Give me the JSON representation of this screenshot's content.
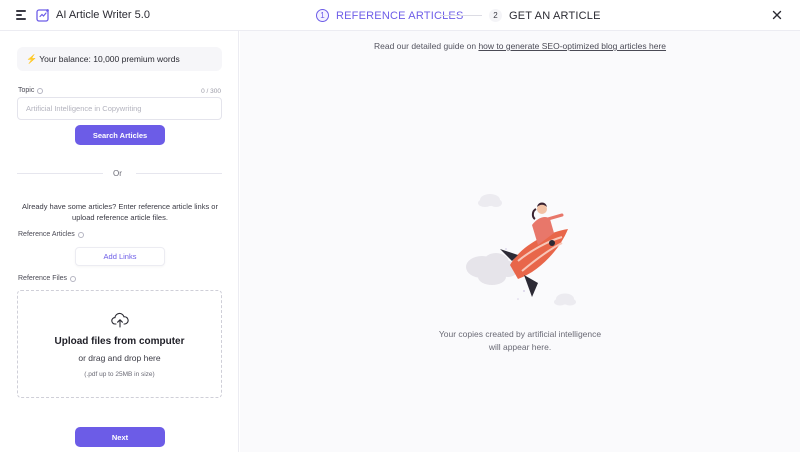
{
  "app": {
    "title": "AI Article Writer 5.0",
    "logo_icon": "ai-writer-logo-icon"
  },
  "steps": [
    {
      "number": "1",
      "label": "REFERENCE ARTICLES",
      "active": true
    },
    {
      "number": "2",
      "label": "GET AN ARTICLE",
      "active": false
    }
  ],
  "left": {
    "balance": "Your balance: 10,000 premium words",
    "topic": {
      "label": "Topic",
      "char_count": "0 / 300",
      "placeholder": "Artificial Intelligence in Copywriting",
      "value": ""
    },
    "search_label": "Search Articles",
    "or_label": "Or",
    "helper_text": "Already have some articles? Enter reference article links or upload reference article files.",
    "reference_articles_label": "Reference Articles",
    "add_links_label": "Add Links",
    "reference_files_label": "Reference Files",
    "dropzone": {
      "title": "Upload files from computer",
      "subtitle": "or drag and drop here",
      "note": "(.pdf up to 25MB in size)"
    },
    "next_label": "Next"
  },
  "right": {
    "guide_prefix": "Read our detailed guide on ",
    "guide_link": "how to generate SEO-optimized blog articles here",
    "empty_line1": "Your copies created by artificial intelligence",
    "empty_line2": "will appear here."
  },
  "colors": {
    "accent": "#6c5ce7",
    "step_active": "#6d5de8",
    "rocket": "#e8664a"
  }
}
